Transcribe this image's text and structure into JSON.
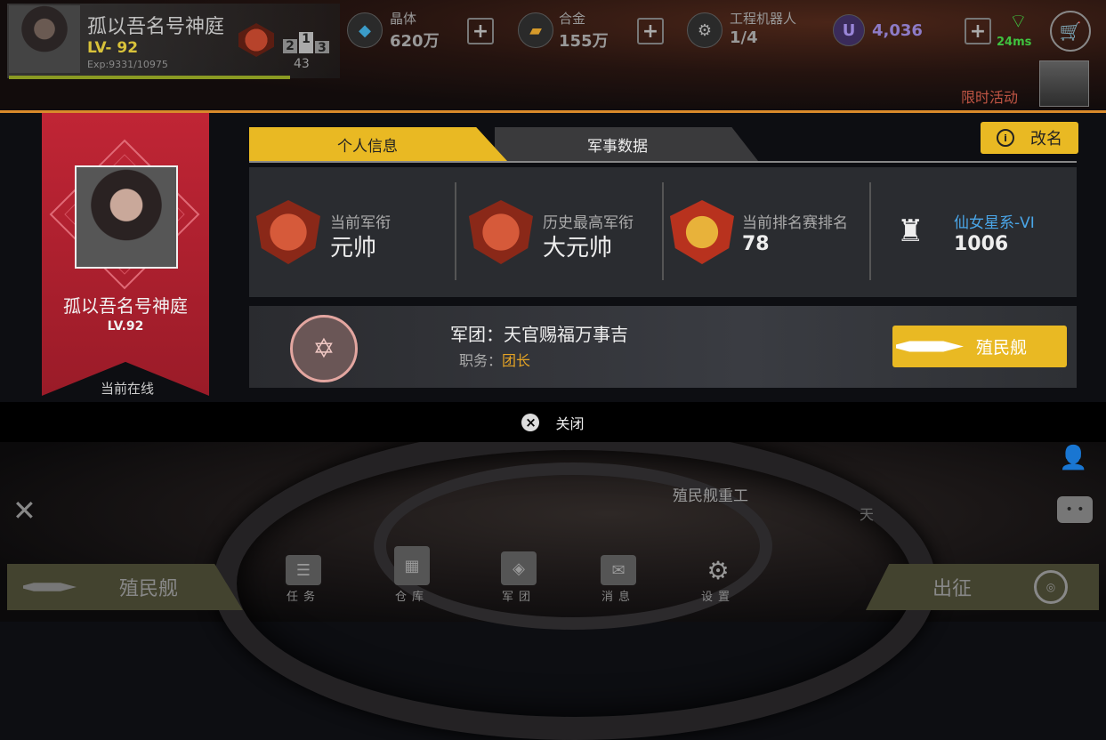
{
  "player": {
    "name": "孤以吾名号神庭",
    "level_label": "LV- 92",
    "exp_label": "Exp:9331/10975",
    "exp_fraction": 0.85,
    "rank_podium": [
      "2",
      "1",
      "3"
    ],
    "rank_number": "43"
  },
  "resources": [
    {
      "name": "晶体",
      "value": "620万",
      "icon": "crystal-icon"
    },
    {
      "name": "合金",
      "value": "155万",
      "icon": "alloy-icon"
    },
    {
      "name": "工程机器人",
      "value": "1/4",
      "icon": "robot-icon"
    }
  ],
  "currency": {
    "symbol": "U",
    "value": "4,036"
  },
  "network": {
    "ping": "24ms"
  },
  "limited_event": "限时活动",
  "modal": {
    "tabs": [
      {
        "label": "个人信息",
        "active": true
      },
      {
        "label": "军事数据",
        "active": false
      }
    ],
    "rename_label": "改名",
    "profile": {
      "name": "孤以吾名号神庭",
      "level": "LV.92",
      "status": "当前在线"
    },
    "stats": [
      {
        "label": "当前军衔",
        "value": "元帅",
        "medal": "rank-medal-icon"
      },
      {
        "label": "历史最高军衔",
        "value": "大元帅",
        "medal": "rank-medal-icon"
      },
      {
        "label": "当前排名赛排名",
        "value": "78",
        "medal": "arena-medal-icon"
      },
      {
        "label": "仙女星系-VI",
        "value": "1006",
        "medal": "trophy-icon"
      }
    ],
    "legion": {
      "label": "军团：",
      "name": "天官赐福万事吉",
      "role_label": "职务：",
      "role": "团长"
    },
    "colony_ship_label": "殖民舰",
    "close_label": "关闭"
  },
  "hud": {
    "colony_ship_label": "殖民舰",
    "deploy_label": "出征",
    "nav": [
      {
        "label": "任务",
        "icon": "task-icon"
      },
      {
        "label": "仓库",
        "icon": "warehouse-icon"
      },
      {
        "label": "军团",
        "icon": "legion-icon"
      },
      {
        "label": "消息",
        "icon": "message-icon"
      },
      {
        "label": "设置",
        "icon": "settings-icon"
      }
    ],
    "factory_label": "殖民舰重工",
    "day_label": "天"
  },
  "colors": {
    "accent_gold": "#e9b923",
    "banner_red": "#c02535",
    "divider_orange": "#d98a2b",
    "ping_green": "#3fc23f",
    "system_blue": "#4aa6e8"
  }
}
